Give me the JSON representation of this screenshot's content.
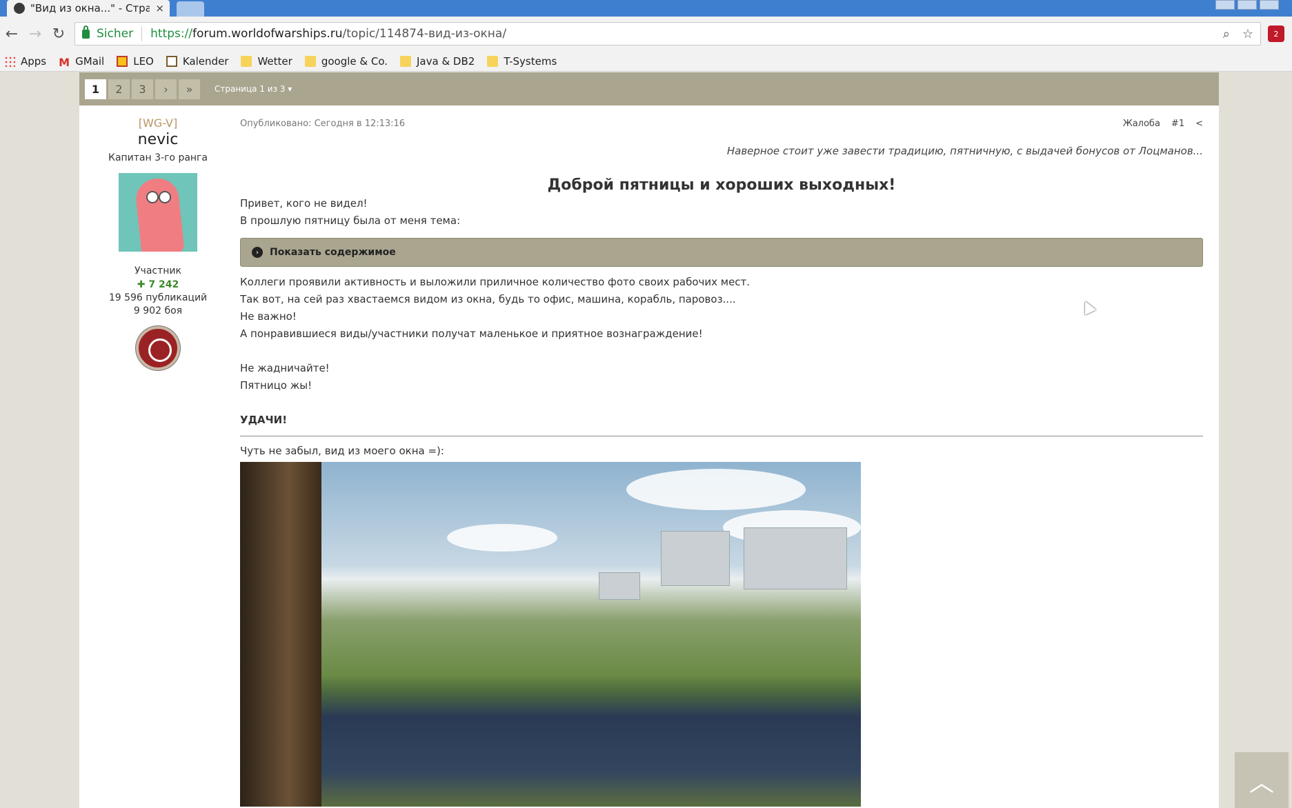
{
  "browser": {
    "tab_title": "\"Вид из окна...\" - Страни",
    "tab_close": "×",
    "nav": {
      "back": "←",
      "forward": "→",
      "reload": "↻"
    },
    "security_label": "Sicher",
    "url_scheme": "https://",
    "url_host": "forum.worldofwarships.ru",
    "url_path": "/topic/114874-вид-из-окна/",
    "icons": {
      "zoom": "zoom-icon",
      "star": "star-icon"
    },
    "extension_badge": "2",
    "bookmarks": [
      {
        "label": "Apps",
        "icon": "apps-icon"
      },
      {
        "label": "GMail",
        "icon": "gmail-icon"
      },
      {
        "label": "LEO",
        "icon": "leo-icon"
      },
      {
        "label": "Kalender",
        "icon": "calendar-icon"
      },
      {
        "label": "Wetter",
        "icon": "folder-icon"
      },
      {
        "label": "google & Co.",
        "icon": "folder-icon"
      },
      {
        "label": "Java & DB2",
        "icon": "folder-icon"
      },
      {
        "label": "T-Systems",
        "icon": "folder-icon"
      }
    ]
  },
  "pagination": {
    "pages": [
      "1",
      "2",
      "3"
    ],
    "active": "1",
    "next": "›",
    "last": "»",
    "label": "Страница 1 из 3 ▾"
  },
  "author": {
    "clan": "[WG-V]",
    "name": "nevic",
    "rank": "Капитан 3-го ранга",
    "role": "Участник",
    "reputation": "✚ 7 242",
    "posts": "19 596 публикаций",
    "battles": "9 902 боя"
  },
  "post": {
    "published": "Опубликовано: Сегодня в 12:13:16",
    "report": "Жалоба",
    "number": "#1",
    "share_icon": "share-icon",
    "tagline": "Наверное стоит уже завести традицию, пятничную, с выдачей бонусов от Лоцманов...",
    "heading": "Доброй пятницы и хороших выходных!",
    "intro": [
      "Привет, кого не видел!",
      "В прошлую пятницу была от меня тема:"
    ],
    "spoiler_label": "Показать содержимое",
    "body": [
      "Коллеги проявили активность и выложили приличное количество фото своих рабочих мест.",
      "Так вот, на сей раз хвастаемся видом из  окна, будь то офис, машина, корабль, паровоз....",
      "Не важно!",
      "А понравившиеся виды/участники получат маленькое и приятное вознаграждение!"
    ],
    "closing": [
      "Не жадничайте!",
      "Пятницо жы!"
    ],
    "luck": "УДАЧИ!",
    "photo_caption": "Чуть не забыл, вид из моего окна =):"
  },
  "scroll_top_icon": "scroll-top-icon",
  "colors": {
    "pagebar": "#a9a58f",
    "page_bg": "#e2e0d6",
    "secure_green": "#1e8e3e",
    "clan_color": "#b89563"
  }
}
